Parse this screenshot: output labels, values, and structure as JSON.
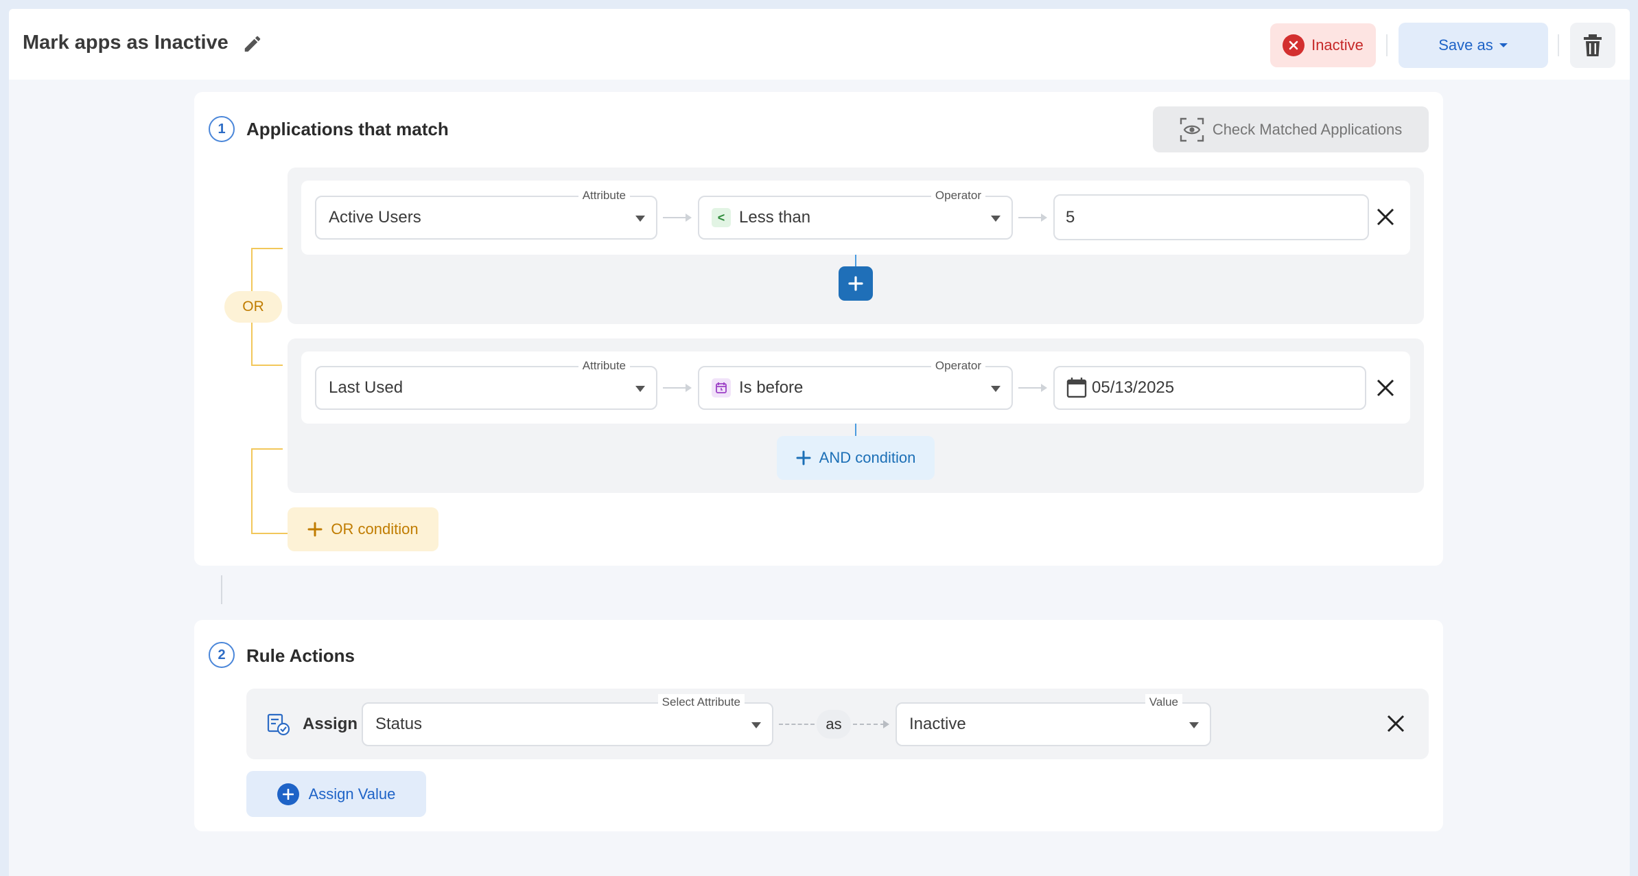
{
  "header": {
    "title": "Mark apps as Inactive",
    "status_label": "Inactive",
    "save_label": "Save as"
  },
  "section1": {
    "number": "1",
    "title": "Applications that match",
    "check_label": "Check Matched Applications",
    "or_label": "OR",
    "groups": [
      {
        "attribute_legend": "Attribute",
        "attribute": "Active Users",
        "operator_legend": "Operator",
        "operator_symbol": "<",
        "operator": "Less than",
        "value": "5"
      },
      {
        "attribute_legend": "Attribute",
        "attribute": "Last Used",
        "operator_legend": "Operator",
        "operator": "Is before",
        "value": "05/13/2025"
      }
    ],
    "and_condition_label": "AND condition",
    "or_condition_label": "OR condition"
  },
  "section2": {
    "number": "2",
    "title": "Rule Actions",
    "assign_label": "Assign",
    "select_attribute_legend": "Select Attribute",
    "attribute": "Status",
    "as_label": "as",
    "value_legend": "Value",
    "value": "Inactive",
    "assign_value_label": "Assign Value"
  },
  "colors": {
    "accent_blue": "#1e63c7",
    "inactive_red": "#d32f2f",
    "or_yellow": "#c07c00"
  }
}
